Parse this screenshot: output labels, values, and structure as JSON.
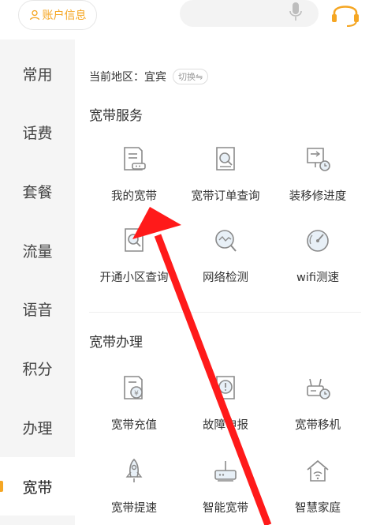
{
  "header": {
    "account_label": "账户信息"
  },
  "sidebar": {
    "items": [
      {
        "label": "常用"
      },
      {
        "label": "话费"
      },
      {
        "label": "套餐"
      },
      {
        "label": "流量"
      },
      {
        "label": "语音"
      },
      {
        "label": "积分"
      },
      {
        "label": "办理"
      },
      {
        "label": "宽带"
      }
    ],
    "active_index": 7
  },
  "main": {
    "region_label": "当前地区：宜宾",
    "region_switch": "切换⇋",
    "sections": [
      {
        "title": "宽带服务",
        "items": [
          {
            "label": "我的宽带",
            "icon": "broadband-doc-icon"
          },
          {
            "label": "宽带订单查询",
            "icon": "order-search-icon"
          },
          {
            "label": "装移修进度",
            "icon": "progress-clock-icon"
          },
          {
            "label": "开通小区查询",
            "icon": "community-search-icon"
          },
          {
            "label": "网络检测",
            "icon": "network-check-icon"
          },
          {
            "label": "wifi测速",
            "icon": "speed-gauge-icon"
          }
        ]
      },
      {
        "title": "宽带办理",
        "items": [
          {
            "label": "宽带充值",
            "icon": "recharge-icon"
          },
          {
            "label": "故障申报",
            "icon": "fault-report-icon"
          },
          {
            "label": "宽带移机",
            "icon": "move-router-icon"
          },
          {
            "label": "宽带提速",
            "icon": "rocket-icon"
          },
          {
            "label": "智能宽带",
            "icon": "smart-router-icon"
          },
          {
            "label": "智慧家庭",
            "icon": "smart-home-icon"
          }
        ]
      }
    ]
  },
  "colors": {
    "accent": "#f5a623",
    "icon_stroke": "#8a8a8a",
    "annotation_arrow": "#ff1a1a"
  }
}
